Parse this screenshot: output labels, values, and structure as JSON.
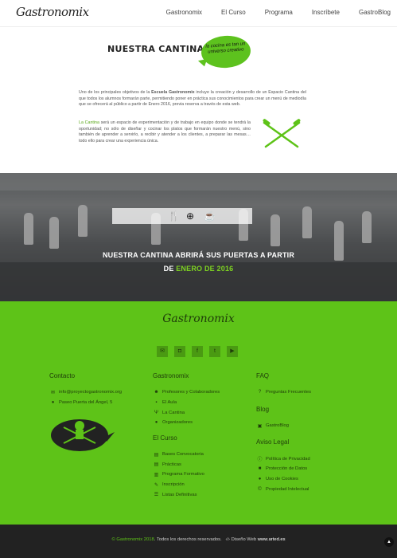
{
  "header": {
    "logo": "Gastronomix",
    "nav": [
      "Gastronomix",
      "El Curso",
      "Programa",
      "Inscríbete",
      "GastroBlog"
    ]
  },
  "intro": {
    "title": "NUESTRA CANTINA",
    "bubble": "la cocina es tan un universo creativo",
    "para1_a": "Uno de los principales objetivos de la ",
    "para1_bold": "Escuela Gastronomix",
    "para1_b": " incluye la creación y desarrollo de un Espacio Cantina del que todos los alumnos formarán parte, permitiendo poner en práctica sus conocimientos para crear un menú de mediodía que se ofrecerá al público a partir de Enero 2016, previa reserva a través de esta web.",
    "para2_hl": "La Cantina",
    "para2_rest": " será un espacio de experimentación y de trabajo en equipo donde se tendrá la oportunidad; no sólo de diseñar y cocinar los platos que formarán nuestro menú, sino también de aprender a servirlo, a recibir y atender a los clientes, a preparar las mesas… todo ello para crear una experiencia única."
  },
  "banner": {
    "line1": "NUESTRA CANTINA ABRIRÁ SUS PUERTAS A PARTIR",
    "line2_a": "DE ",
    "line2_hl": "ENERO DE 2016"
  },
  "footer": {
    "logo": "Gastronomix",
    "socials": [
      "email-icon",
      "instagram-icon",
      "facebook-icon",
      "twitter-icon",
      "youtube-icon"
    ],
    "contacto": {
      "title": "Contacto",
      "items": [
        "info@proyectogastronomix.org",
        "Paseo Puerta del Ángel, 5"
      ]
    },
    "gastronomix": {
      "title": "Gastronomix",
      "items": [
        "Profesores y Colaboradores",
        "El Aula",
        "La Cantina",
        "Organizadores"
      ]
    },
    "elcurso": {
      "title": "El Curso",
      "items": [
        "Bases Convocatoria",
        "Prácticas",
        "Programa Formativo",
        "Inscripción",
        "Listas Definitivas"
      ]
    },
    "faq": {
      "title": "FAQ",
      "items": [
        "Preguntas Frecuentes"
      ]
    },
    "blog": {
      "title": "Blog",
      "items": [
        "GastroBlog"
      ]
    },
    "legal": {
      "title": "Aviso Legal",
      "items": [
        "Política de Privacidad",
        "Protección de Datos",
        "Uso de Cookies",
        "Propiedad Intelectual"
      ]
    }
  },
  "bottom": {
    "copy_brand": "© Gastronomix 2018",
    "copy_rest": ". Todos los derechos reservados.",
    "design_label": "Diseño Web",
    "design_site": "www.arted.es"
  }
}
